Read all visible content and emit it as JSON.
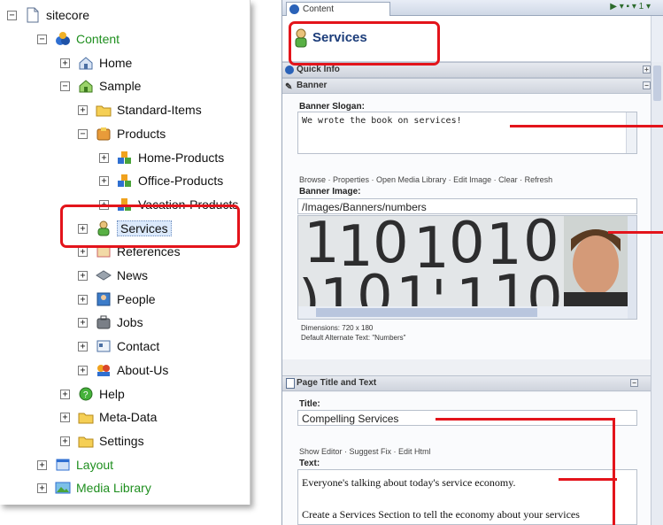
{
  "tree": {
    "root": "sitecore",
    "items": [
      {
        "label": "Content",
        "level": 1,
        "exp": "−"
      },
      {
        "label": "Home",
        "level": 2,
        "exp": "+"
      },
      {
        "label": "Sample",
        "level": 2,
        "exp": "−"
      },
      {
        "label": "Standard-Items",
        "level": 3,
        "exp": "+"
      },
      {
        "label": "Products",
        "level": 3,
        "exp": "−"
      },
      {
        "label": "Home-Products",
        "level": 4,
        "exp": "+"
      },
      {
        "label": "Office-Products",
        "level": 4,
        "exp": "+"
      },
      {
        "label": "Vacation-Products",
        "level": 4,
        "exp": "+"
      },
      {
        "label": "Services",
        "level": 3,
        "exp": "+"
      },
      {
        "label": "References",
        "level": 3,
        "exp": "+"
      },
      {
        "label": "News",
        "level": 3,
        "exp": "+"
      },
      {
        "label": "People",
        "level": 3,
        "exp": "+"
      },
      {
        "label": "Jobs",
        "level": 3,
        "exp": "+"
      },
      {
        "label": "Contact",
        "level": 3,
        "exp": "+"
      },
      {
        "label": "About-Us",
        "level": 3,
        "exp": "+"
      },
      {
        "label": "Help",
        "level": 2,
        "exp": "+"
      },
      {
        "label": "Meta-Data",
        "level": 2,
        "exp": "+"
      },
      {
        "label": "Settings",
        "level": 2,
        "exp": "+"
      },
      {
        "label": "Layout",
        "level": 1,
        "exp": "+"
      },
      {
        "label": "Media Library",
        "level": 1,
        "exp": "+"
      }
    ]
  },
  "editor": {
    "tab_label": "Content",
    "item_title": "Services",
    "quick_info": "Quick Info",
    "banner_section": "Banner",
    "banner_slogan_label": "Banner Slogan:",
    "banner_slogan_value": "We wrote the book on services!",
    "image_links": "Browse · Properties · Open Media Library · Edit Image · Clear · Refresh",
    "banner_image_label": "Banner Image:",
    "banner_image_path": "/Images/Banners/numbers",
    "dimensions": "Dimensions: 720 x 180",
    "alt_text": "Default Alternate Text: \"Numbers\"",
    "page_section": "Page Title and Text",
    "title_label": "Title:",
    "title_value": "Compelling Services",
    "text_links": "Show Editor · Suggest Fix · Edit Html",
    "text_label": "Text:",
    "text_line1": "Everyone's talking about today's service economy.",
    "text_line2": "Create a Services Section to tell the economy about your services"
  },
  "colors": {
    "highlight": "#e3141b",
    "tree_green": "#1f8f1f",
    "title_blue": "#1c3d7a"
  }
}
